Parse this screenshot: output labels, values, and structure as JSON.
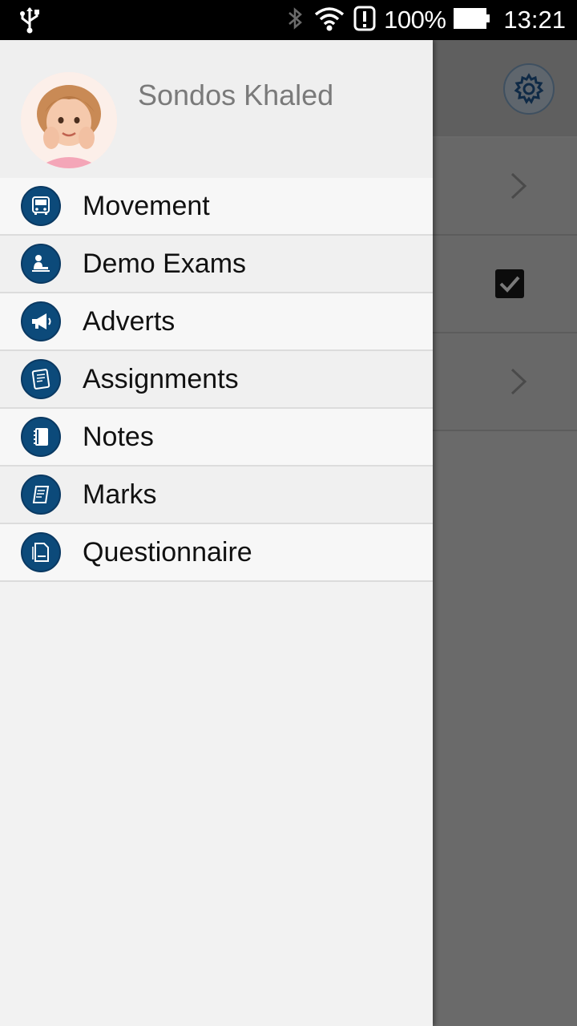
{
  "status_bar": {
    "battery_percent": "100%",
    "time": "13:21",
    "icons": [
      "usb-icon",
      "bluetooth-icon",
      "wifi-icon",
      "alert-icon",
      "battery-icon"
    ]
  },
  "drawer": {
    "user_name": "Sondos Khaled",
    "items": [
      {
        "label": "Movement",
        "icon": "bus-icon"
      },
      {
        "label": "Demo Exams",
        "icon": "student-desk-icon"
      },
      {
        "label": "Adverts",
        "icon": "megaphone-icon"
      },
      {
        "label": "Assignments",
        "icon": "homework-icon"
      },
      {
        "label": "Notes",
        "icon": "notebook-icon"
      },
      {
        "label": "Marks",
        "icon": "scroll-icon"
      },
      {
        "label": "Questionnaire",
        "icon": "document-icon"
      }
    ]
  },
  "background_screen": {
    "icons": [
      "gear-icon",
      "chevron-right-icon",
      "checkbox-checked-icon",
      "chevron-right-icon"
    ]
  },
  "colors": {
    "icon_bg": "#0c4a7a",
    "drawer_bg": "#f2f2f2",
    "scrim": "#6a6a6a"
  }
}
